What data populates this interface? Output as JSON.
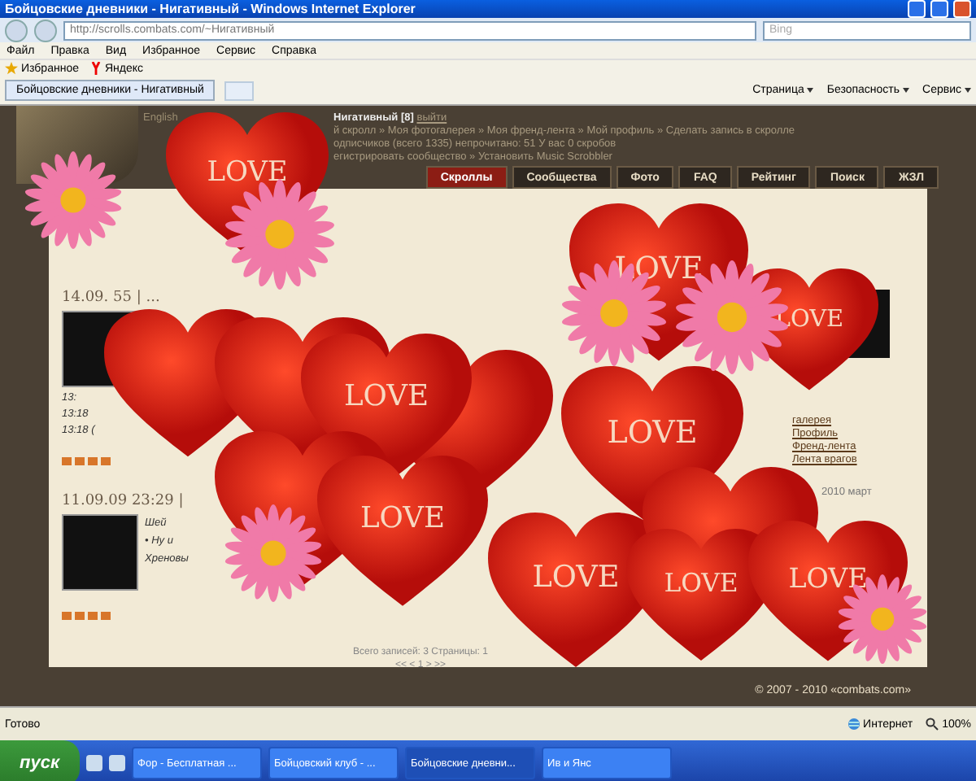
{
  "window": {
    "title": "Бойцовские дневники - Нигативный - Windows Internet Explorer"
  },
  "address": {
    "url": "http://scrolls.combats.com/~Нигативный"
  },
  "search": {
    "placeholder": "Bing"
  },
  "menu": [
    "Файл",
    "Правка",
    "Вид",
    "Избранное",
    "Сервис",
    "Справка"
  ],
  "favorites": [
    {
      "kind": "star",
      "label": "Избранное"
    },
    {
      "kind": "yandex",
      "label": "Яндекс"
    }
  ],
  "tab": {
    "title": "Бойцовские дневники - Нигативный"
  },
  "command_bar": [
    "Страница",
    "Безопасность",
    "Сервис"
  ],
  "site": {
    "user": "Нигативный [8]",
    "logout": "выйти",
    "lang": "English",
    "nav_lines": [
      "й скролл » Моя фотогалерея » Моя френд-лента » Мой профиль » Сделать запись в скролле",
      "одписчиков (всего 1335) непрочитано: 51 У вас 0 скробов",
      "егистрировать сообщество » Установить Music Scrobbler"
    ],
    "tabs": [
      {
        "label": "Скроллы",
        "selected": true
      },
      {
        "label": "Сообщества",
        "selected": false
      },
      {
        "label": "Фото",
        "selected": false
      },
      {
        "label": "FAQ",
        "selected": false
      },
      {
        "label": "Рейтинг",
        "selected": false
      },
      {
        "label": "Поиск",
        "selected": false
      },
      {
        "label": "ЖЗЛ",
        "selected": false
      }
    ],
    "posts": [
      {
        "date": "14.09.",
        "time": "55",
        "sep": "| ...",
        "under": [
          "13:",
          "13:18",
          "13:18 ("
        ]
      },
      {
        "date": "11.09.09 23:29",
        "sep": "|",
        "lines": [
          "Шей",
          "• Ну и",
          "Хреновы"
        ]
      }
    ],
    "sidebar": [
      "галерея",
      "Профиль",
      "Френд-лента",
      "Лента врагов"
    ],
    "calendar": "2010 март",
    "pager": {
      "summary": "Всего записей: 3 Страницы: 1",
      "nav": "<< < 1 > >>"
    },
    "footer": "© 2007 - 2010 «combats.com»"
  },
  "stickers": [
    {
      "kind": "heart",
      "label": "LOVE"
    },
    {
      "kind": "heart",
      "label": "LOVE"
    },
    {
      "kind": "heart"
    },
    {
      "kind": "heart"
    },
    {
      "kind": "heart"
    },
    {
      "kind": "heart",
      "label": "LOVE"
    },
    {
      "kind": "heart",
      "label": "LOVE"
    },
    {
      "kind": "heart",
      "label": "LOVE"
    },
    {
      "kind": "heart"
    },
    {
      "kind": "heart",
      "label": "LOVE"
    },
    {
      "kind": "heart",
      "label": "LOVE"
    },
    {
      "kind": "heart"
    },
    {
      "kind": "heart",
      "label": "LOVE"
    },
    {
      "kind": "heart",
      "label": "LOVE"
    },
    {
      "kind": "flower"
    },
    {
      "kind": "flower"
    },
    {
      "kind": "flower"
    },
    {
      "kind": "flower"
    },
    {
      "kind": "flower"
    },
    {
      "kind": "flower"
    }
  ],
  "status_bar": {
    "text": "Готово",
    "zone": "Интернет",
    "zoom": "100%"
  },
  "taskbar": {
    "start": "пуск",
    "items": [
      {
        "label": "Фор - Бесплатная ...",
        "selected": false
      },
      {
        "label": "Бойцовский клуб - ...",
        "selected": false
      },
      {
        "label": "Бойцовские дневни...",
        "selected": true
      },
      {
        "label": "Ив и Янс",
        "selected": false
      }
    ]
  }
}
